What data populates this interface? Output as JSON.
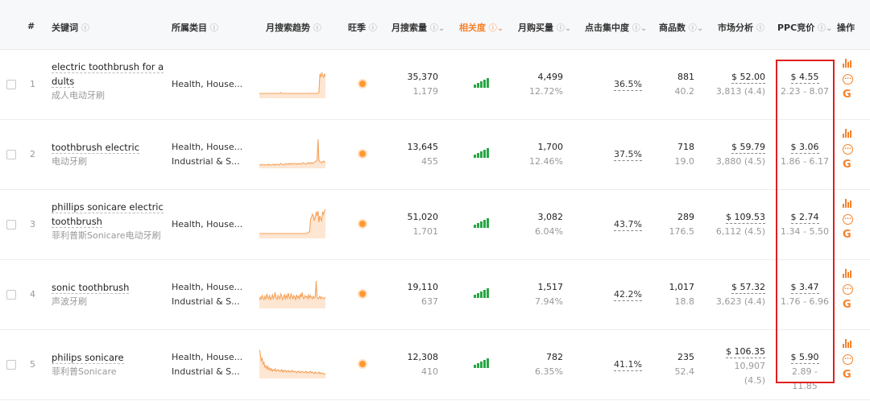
{
  "headers": {
    "index": "#",
    "keyword": "关键词",
    "category": "所属类目",
    "trend": "月搜索趋势",
    "season": "旺季",
    "monthly_search": "月搜索量",
    "relevance": "相关度",
    "monthly_purchase": "月购买量",
    "click_conc": "点击集中度",
    "products": "商品数",
    "market": "市场分析",
    "ppc": "PPC竞价",
    "ops": "操作",
    "help_icon": "?",
    "sort_icon": "⌄"
  },
  "rows": [
    {
      "index": "1",
      "kw_en_line1": "electric toothbrush for a",
      "kw_en_line2": "dults",
      "kw_cn": "成人电动牙刷",
      "cat_line1": "Health, House...",
      "cat_line2": "",
      "search": "35,370",
      "search_sub": "1,179",
      "purchase": "4,499",
      "purchase_rate": "12.72%",
      "click": "36.5%",
      "products": "881",
      "products_sub": "40.2",
      "market_price": "$ 52.00",
      "market_sub": "3,813 (4.4)",
      "market_sub2": "",
      "ppc": "$ 4.55",
      "ppc_range": "2.23 - 8.07",
      "spark": [
        6,
        6,
        6,
        6,
        6,
        6,
        6,
        6,
        6,
        6,
        6,
        6,
        6,
        6,
        6,
        6,
        6,
        6,
        6,
        6,
        6,
        6,
        6,
        7,
        6,
        6,
        6,
        6,
        6,
        6,
        6,
        6,
        6,
        6,
        6,
        6,
        6,
        6,
        6,
        6,
        6,
        6,
        6,
        6,
        6,
        6,
        6,
        6,
        6,
        6,
        6,
        6,
        6,
        6,
        6,
        6,
        6,
        6,
        6,
        6,
        6,
        6,
        6,
        6,
        7,
        30,
        27,
        32,
        28,
        26,
        30,
        27
      ]
    },
    {
      "index": "2",
      "kw_en_line1": "toothbrush electric",
      "kw_en_line2": "",
      "kw_cn": "电动牙刷",
      "cat_line1": "Health, House...",
      "cat_line2": "Industrial & S...",
      "search": "13,645",
      "search_sub": "455",
      "purchase": "1,700",
      "purchase_rate": "12.46%",
      "click": "37.5%",
      "products": "718",
      "products_sub": "19.0",
      "market_price": "$ 59.79",
      "market_sub": "3,880 (4.5)",
      "market_sub2": "",
      "ppc": "$ 3.06",
      "ppc_range": "1.86 - 6.17",
      "spark": [
        4,
        4,
        5,
        4,
        4,
        5,
        4,
        4,
        4,
        5,
        4,
        5,
        4,
        4,
        5,
        5,
        4,
        5,
        4,
        5,
        5,
        4,
        5,
        6,
        5,
        5,
        4,
        5,
        6,
        5,
        5,
        6,
        5,
        6,
        5,
        6,
        6,
        5,
        6,
        6,
        5,
        6,
        5,
        6,
        6,
        5,
        6,
        7,
        6,
        6,
        5,
        6,
        7,
        6,
        7,
        6,
        7,
        6,
        7,
        7,
        8,
        9,
        10,
        36,
        10,
        8,
        8,
        7,
        8,
        9,
        8,
        7
      ]
    },
    {
      "index": "3",
      "kw_en_line1": "phillips sonicare electric",
      "kw_en_line2": "toothbrush",
      "kw_cn": "菲利普斯Sonicare电动牙刷",
      "cat_line1": "Health, House...",
      "cat_line2": "",
      "search": "51,020",
      "search_sub": "1,701",
      "purchase": "3,082",
      "purchase_rate": "6.04%",
      "click": "43.7%",
      "products": "289",
      "products_sub": "176.5",
      "market_price": "$ 109.53",
      "market_sub": "6,112 (4.5)",
      "market_sub2": "",
      "ppc": "$ 2.74",
      "ppc_range": "1.34 - 5.50",
      "spark": [
        6,
        6,
        6,
        6,
        6,
        6,
        6,
        6,
        6,
        6,
        6,
        6,
        6,
        6,
        6,
        6,
        6,
        6,
        6,
        6,
        6,
        6,
        6,
        6,
        6,
        6,
        6,
        6,
        6,
        6,
        6,
        6,
        6,
        6,
        6,
        6,
        6,
        6,
        6,
        6,
        6,
        6,
        6,
        6,
        6,
        6,
        6,
        6,
        6,
        6,
        6,
        6,
        7,
        8,
        8,
        24,
        26,
        30,
        28,
        22,
        26,
        32,
        29,
        34,
        20,
        28,
        24,
        22,
        33,
        30,
        34,
        36
      ]
    },
    {
      "index": "4",
      "kw_en_line1": "sonic toothbrush",
      "kw_en_line2": "",
      "kw_cn": "声波牙刷",
      "cat_line1": "Health, House...",
      "cat_line2": "Industrial & S...",
      "search": "19,110",
      "search_sub": "637",
      "purchase": "1,517",
      "purchase_rate": "7.94%",
      "click": "42.2%",
      "products": "1,017",
      "products_sub": "18.8",
      "market_price": "$ 57.32",
      "market_sub": "3,623 (4.4)",
      "market_sub2": "",
      "ppc": "$ 3.47",
      "ppc_range": "1.76 - 6.96",
      "spark": [
        10,
        14,
        12,
        16,
        13,
        11,
        15,
        12,
        18,
        14,
        12,
        16,
        11,
        13,
        17,
        12,
        15,
        20,
        13,
        11,
        16,
        14,
        12,
        18,
        15,
        11,
        14,
        17,
        12,
        16,
        13,
        19,
        14,
        12,
        18,
        15,
        12,
        16,
        14,
        11,
        17,
        13,
        15,
        12,
        18,
        14,
        20,
        13,
        12,
        16,
        14,
        15,
        12,
        17,
        13,
        16,
        14,
        12,
        15,
        13,
        14,
        34,
        14,
        12,
        13,
        15,
        12,
        14,
        13,
        12,
        13,
        14
      ]
    },
    {
      "index": "5",
      "kw_en_line1": "philips sonicare",
      "kw_en_line2": "",
      "kw_cn": "菲利普Sonicare",
      "cat_line1": "Health, House...",
      "cat_line2": "Industrial & S...",
      "search": "12,308",
      "search_sub": "410",
      "purchase": "782",
      "purchase_rate": "6.35%",
      "click": "41.1%",
      "products": "235",
      "products_sub": "52.4",
      "market_price": "$ 106.35",
      "market_sub": "10,907",
      "market_sub2": "(4.5)",
      "ppc": "$ 5.90",
      "ppc_range": "2.89 - 11.85",
      "spark": [
        36,
        30,
        22,
        25,
        18,
        20,
        14,
        16,
        12,
        15,
        11,
        13,
        10,
        12,
        9,
        11,
        10,
        12,
        9,
        10,
        11,
        9,
        10,
        9,
        11,
        8,
        10,
        9,
        10,
        8,
        9,
        10,
        8,
        9,
        8,
        10,
        9,
        8,
        9,
        8,
        7,
        9,
        8,
        9,
        7,
        8,
        9,
        8,
        7,
        8,
        9,
        7,
        8,
        7,
        8,
        9,
        7,
        8,
        7,
        6,
        8,
        7,
        6,
        7,
        8,
        6,
        7,
        6,
        7,
        6,
        5,
        6
      ]
    }
  ],
  "colors": {
    "accent": "#f5822a",
    "relevance_bar": "#27a744",
    "highlight_box": "#e02020",
    "spark_line": "#f5a25a",
    "spark_fill": "#fde6d2"
  },
  "op_icons": [
    "bar-chart-icon",
    "more-icon",
    "google-icon"
  ],
  "op_google": "G",
  "op_more": "···"
}
